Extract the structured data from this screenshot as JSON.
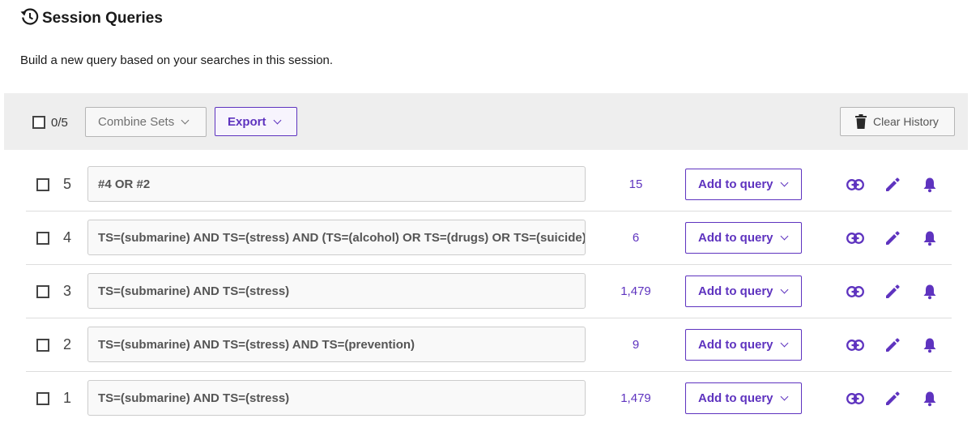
{
  "header": {
    "title": "Session Queries",
    "subtitle": "Build a new query based on your searches in this session."
  },
  "toolbar": {
    "selected_count": "0/5",
    "combine_label": "Combine Sets",
    "export_label": "Export",
    "clear_label": "Clear History"
  },
  "rows": [
    {
      "number": "5",
      "query": "#4 OR #2",
      "results": "15",
      "add_label": "Add to query"
    },
    {
      "number": "4",
      "query": "TS=(submarine) AND TS=(stress) AND (TS=(alcohol) OR TS=(drugs) OR TS=(suicide))",
      "results": "6",
      "add_label": "Add to query"
    },
    {
      "number": "3",
      "query": "TS=(submarine) AND TS=(stress)",
      "results": "1,479",
      "add_label": "Add to query"
    },
    {
      "number": "2",
      "query": "TS=(submarine) AND TS=(stress) AND TS=(prevention)",
      "results": "9",
      "add_label": "Add to query"
    },
    {
      "number": "1",
      "query": "TS=(submarine) AND TS=(stress)",
      "results": "1,479",
      "add_label": "Add to query"
    }
  ],
  "icons": {
    "header": "history-icon",
    "row_actions": [
      "link-icon",
      "edit-icon",
      "alert-bell-icon"
    ],
    "clear": "trash-icon"
  },
  "colors": {
    "accent": "#5e33bf",
    "toolbar_bg": "#eeeeee"
  }
}
